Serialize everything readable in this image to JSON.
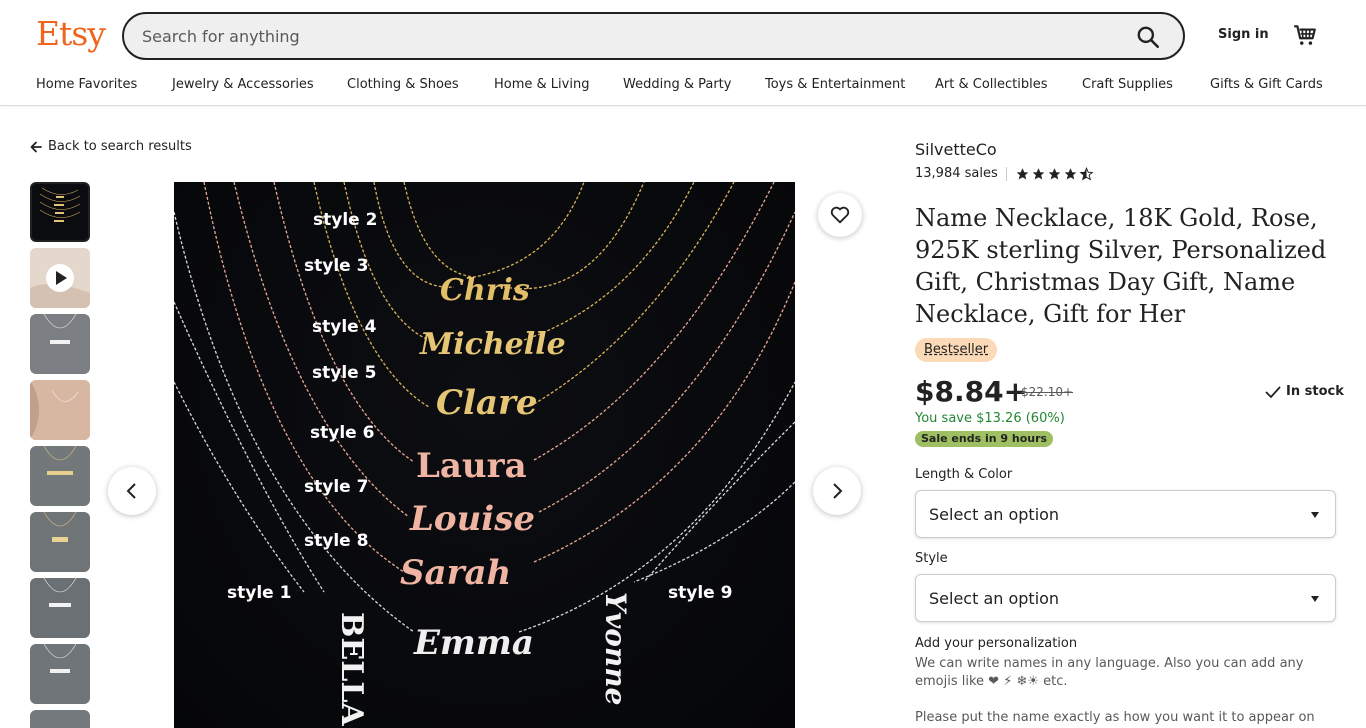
{
  "header": {
    "logo": "Etsy",
    "search_placeholder": "Search for anything",
    "signin": "Sign in"
  },
  "nav": {
    "items": [
      "Home Favorites",
      "Jewelry & Accessories",
      "Clothing & Shoes",
      "Home & Living",
      "Wedding & Party",
      "Toys & Entertainment",
      "Art & Collectibles",
      "Craft Supplies",
      "Gifts & Gift Cards"
    ]
  },
  "back_link": "Back to search results",
  "image": {
    "labels": [
      "style 2",
      "style 3",
      "style 4",
      "style 5",
      "style 6",
      "style 7",
      "style 8",
      "style 1",
      "style 9"
    ],
    "names": [
      "Chris",
      "Michelle",
      "Clare",
      "Laura",
      "Louise",
      "Sarah",
      "Emma",
      "BELLA",
      "Yvonne"
    ]
  },
  "listing": {
    "shop": "SilvetteCo",
    "sales": "13,984 sales",
    "rating": 4.5,
    "title": "Name Necklace, 18K Gold, Rose, 925K sterling Silver, Personalized Gift, Christmas Day Gift, Name Necklace, Gift for Her",
    "badge": "Bestseller",
    "price": "$8.84+",
    "original_price": "$22.10+",
    "stock": "In stock",
    "save": "You save $13.26 (60%)",
    "sale": "Sale ends in 9 hours"
  },
  "options": {
    "length_label": "Length & Color",
    "length_value": "Select an option",
    "style_label": "Style",
    "style_value": "Select an option"
  },
  "personalization": {
    "title": "Add your personalization",
    "text": "We can write names in any language. Also you can add any emojis like ❤ ⚡     ❄☀   etc.",
    "text2": "Please put the name exactly as how you want it to appear on the"
  },
  "colors": {
    "brand": "#f1641e",
    "gold": "#d9b25a",
    "rose": "#e8a795",
    "silver": "#d8d8d8",
    "save_green": "#258635",
    "sale_badge": "#9ec063",
    "bestseller": "#fcd9b7"
  }
}
